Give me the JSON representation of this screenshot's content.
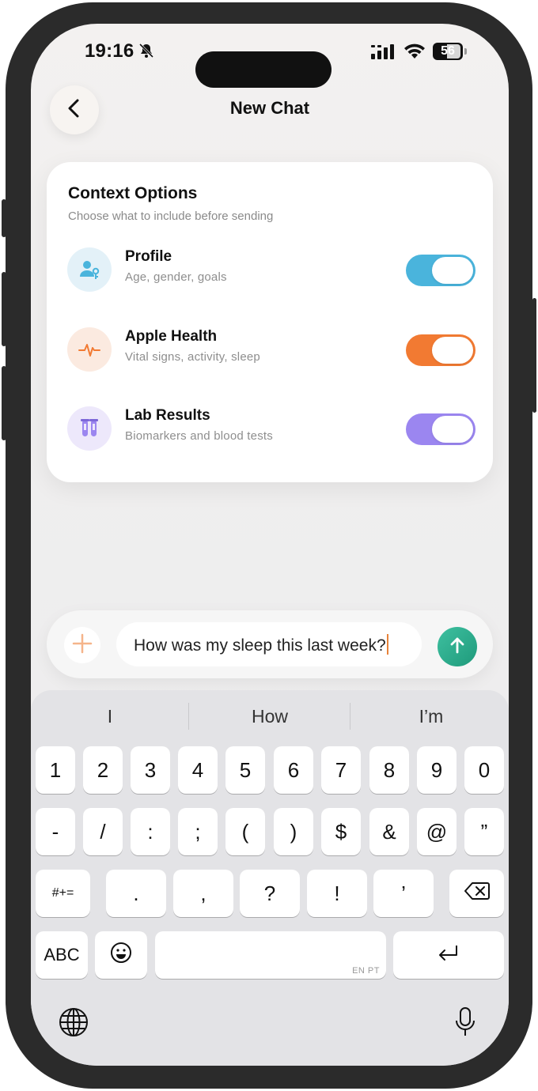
{
  "status_bar": {
    "time": "19:16",
    "battery": "56"
  },
  "header": {
    "title": "New Chat"
  },
  "context_card": {
    "title": "Context Options",
    "subtitle": "Choose what to include before sending",
    "options": [
      {
        "label": "Profile",
        "description": "Age, gender, goals",
        "enabled": true,
        "color": "#4ab4dc",
        "icon": "person-key-icon"
      },
      {
        "label": "Apple Health",
        "description": "Vital signs, activity, sleep",
        "enabled": true,
        "color": "#f27a32",
        "icon": "heartbeat-icon"
      },
      {
        "label": "Lab Results",
        "description": "Biomarkers and blood tests",
        "enabled": true,
        "color": "#9b86f0",
        "icon": "test-tubes-icon"
      }
    ]
  },
  "composer": {
    "message": "How was my sleep this last week?"
  },
  "keyboard": {
    "suggestions": [
      "I",
      "How",
      "I’m"
    ],
    "row1": [
      "1",
      "2",
      "3",
      "4",
      "5",
      "6",
      "7",
      "8",
      "9",
      "0"
    ],
    "row2": [
      "-",
      "/",
      ":",
      ";",
      "(",
      ")",
      "$",
      "&",
      "@",
      "”"
    ],
    "row3": [
      ".",
      ",",
      "?",
      "!",
      "’"
    ],
    "symbols_key": "#+=",
    "abc_key": "ABC",
    "space_lang": "EN PT"
  }
}
